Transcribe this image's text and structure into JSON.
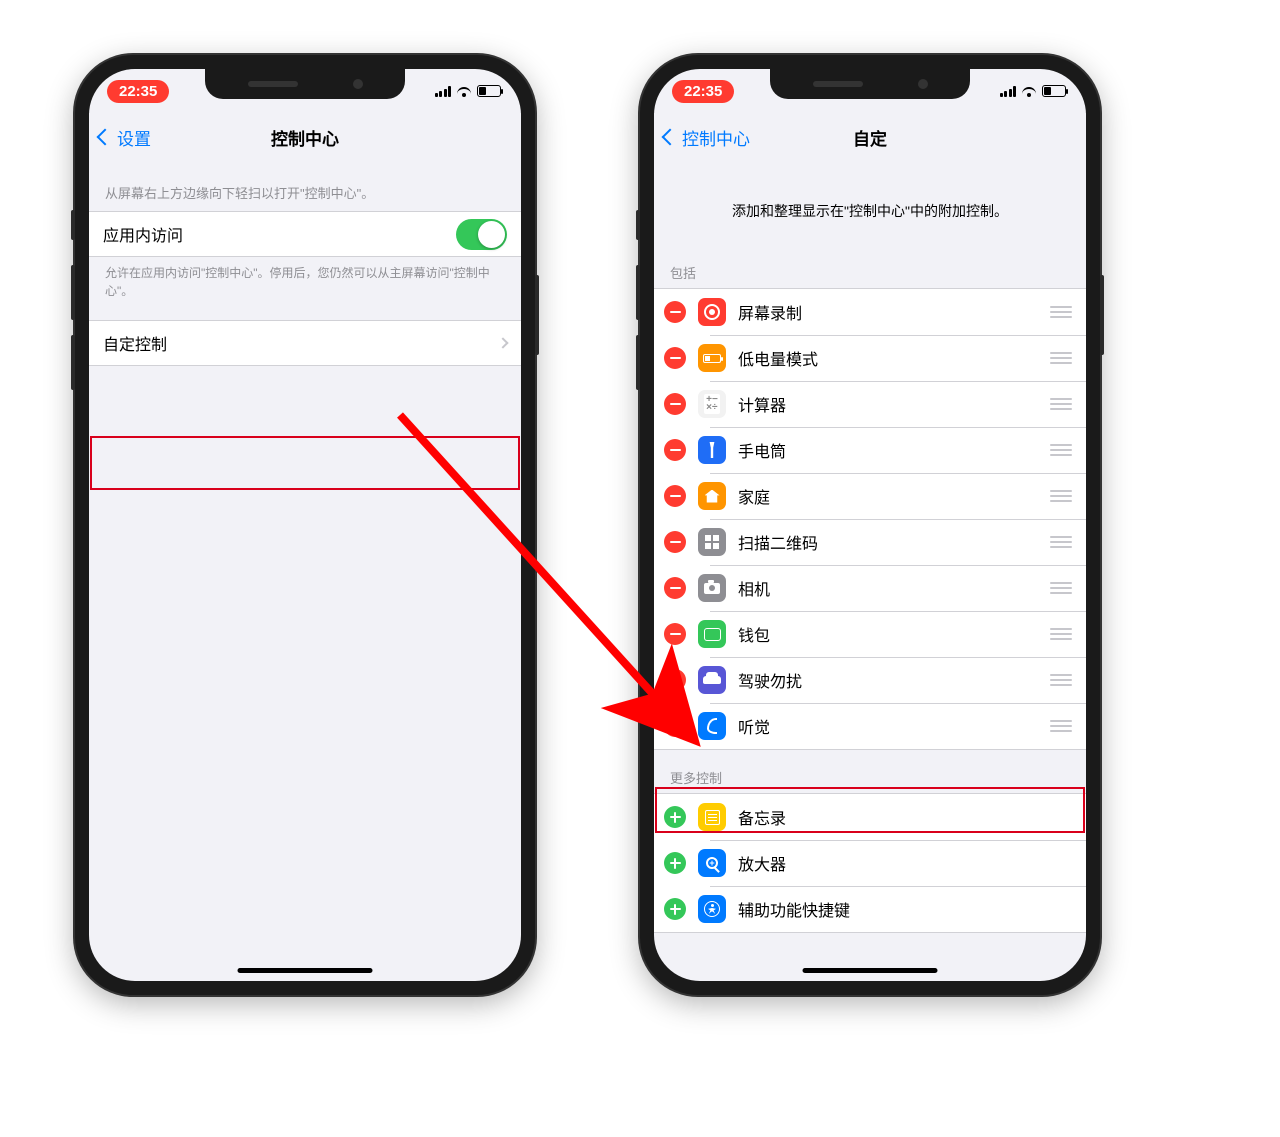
{
  "left": {
    "status_time": "22:35",
    "back_label": "设置",
    "title": "控制中心",
    "hint_top": "从屏幕右上方边缘向下轻扫以打开\"控制中心\"。",
    "toggle_label": "应用内访问",
    "toggle_footer": "允许在应用内访问\"控制中心\"。停用后，您仍然可以从主屏幕访问\"控制中心\"。",
    "customize_label": "自定控制"
  },
  "right": {
    "status_time": "22:35",
    "back_label": "控制中心",
    "title": "自定",
    "instruction": "添加和整理显示在\"控制中心\"中的附加控制。",
    "section_included": "包括",
    "section_more": "更多控制",
    "included": [
      {
        "label": "屏幕录制",
        "icon_bg": "#ff3b30",
        "icon": "rec"
      },
      {
        "label": "低电量模式",
        "icon_bg": "#ff9500",
        "icon": "batt"
      },
      {
        "label": "计算器",
        "icon_bg": "#f2f2f2",
        "icon": "calc"
      },
      {
        "label": "手电筒",
        "icon_bg": "#1f6df6",
        "icon": "torch"
      },
      {
        "label": "家庭",
        "icon_bg": "#ff9500",
        "icon": "home"
      },
      {
        "label": "扫描二维码",
        "icon_bg": "#8e8e93",
        "icon": "qr"
      },
      {
        "label": "相机",
        "icon_bg": "#8e8e93",
        "icon": "cam"
      },
      {
        "label": "钱包",
        "icon_bg": "#34c759",
        "icon": "wallet"
      },
      {
        "label": "驾驶勿扰",
        "icon_bg": "#5856d6",
        "icon": "car"
      },
      {
        "label": "听觉",
        "icon_bg": "#007aff",
        "icon": "ear"
      }
    ],
    "more": [
      {
        "label": "备忘录",
        "icon_bg": "#ffcc00",
        "icon": "note"
      },
      {
        "label": "放大器",
        "icon_bg": "#007aff",
        "icon": "mag"
      },
      {
        "label": "辅助功能快捷键",
        "icon_bg": "#007aff",
        "icon": "acc"
      }
    ]
  }
}
